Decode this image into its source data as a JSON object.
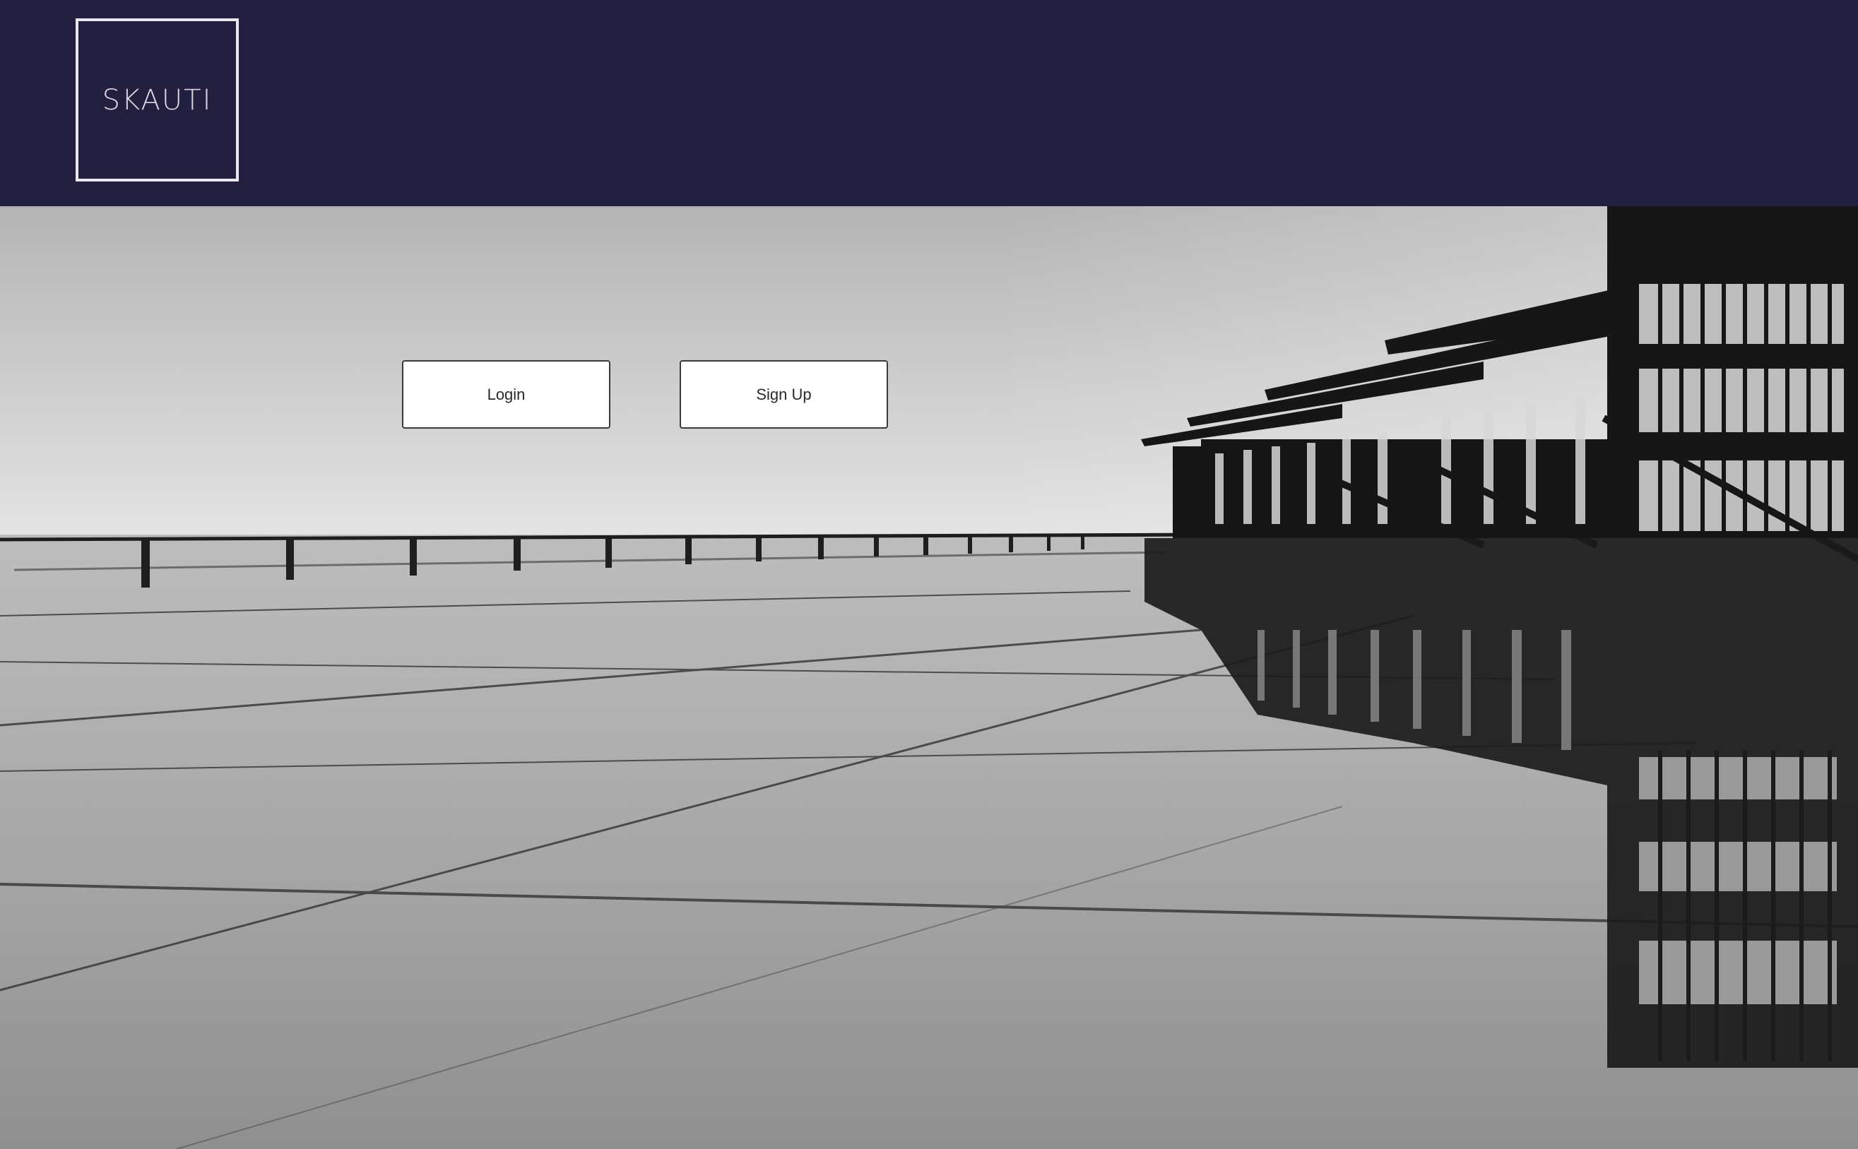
{
  "header": {
    "logo_text": "SKAUTI",
    "background_color": "#231f3f"
  },
  "actions": {
    "login_label": "Login",
    "signup_label": "Sign Up"
  },
  "hero": {
    "image_style": "monochrome architectural photograph"
  }
}
